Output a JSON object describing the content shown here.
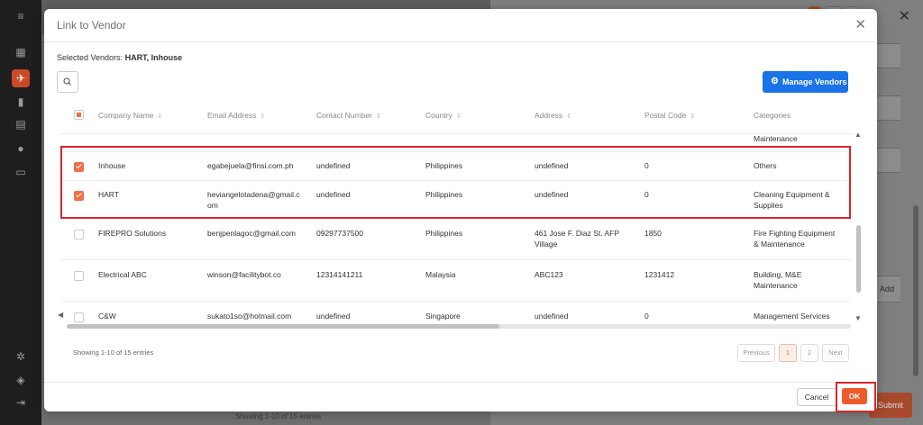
{
  "modal": {
    "title": "Link to Vendor",
    "selected_label": "Selected Vendors:",
    "selected_value": "HART, Inhouse",
    "manage_label": "Manage Vendors",
    "cancel_label": "Cancel",
    "ok_label": "OK"
  },
  "table": {
    "headers": [
      "Company Name",
      "Email Address",
      "Contact Number",
      "Country",
      "Address",
      "Postal Code",
      "Categories"
    ],
    "top_partial_category": "Maintenance",
    "rows": [
      {
        "checked": true,
        "name": "Inhouse",
        "email": "egabejuela@finsi.com.ph",
        "contact": "undefined",
        "country": "Philippines",
        "address": "undefined",
        "postal": "0",
        "category": "Others"
      },
      {
        "checked": true,
        "name": "HART",
        "email": "heviangelotadena@gmail.c om",
        "contact": "undefined",
        "country": "Philippines",
        "address": "undefined",
        "postal": "0",
        "category": "Cleaning Equipment & Supplies"
      },
      {
        "checked": false,
        "name": "FIREPRO Solutions",
        "email": "benjpenlagoc@gmail.com",
        "contact": "09297737500",
        "country": "Philippines",
        "address": "461 Jose F. Diaz St. AFP Village",
        "postal": "1850",
        "category": "Fire Fighting Equipment & Maintenance"
      },
      {
        "checked": false,
        "name": "Electrical ABC",
        "email": "winson@facilitybot.co",
        "contact": "12314141211",
        "country": "Malaysia",
        "address": "ABC123",
        "postal": "1231412",
        "category": "Building, M&E Maintenance"
      },
      {
        "checked": false,
        "name": "C&W",
        "email": "sukato1so@hotmail.com",
        "contact": "undefined",
        "country": "Singapore",
        "address": "undefined",
        "postal": "0",
        "category": "Management Services"
      }
    ]
  },
  "pagination": {
    "showing": "Showing 1-10 of 15 entries",
    "previous": "Previous",
    "page1": "1",
    "page2": "2",
    "next": "Next"
  },
  "background": {
    "left_footer": "Showing 1-10 of 15 entries",
    "add_label": "Add",
    "submit_label": "Submit"
  },
  "colors": {
    "accent": "#ee5a2a",
    "primary_button": "#1a73e8",
    "annotation": "#d9262c"
  }
}
